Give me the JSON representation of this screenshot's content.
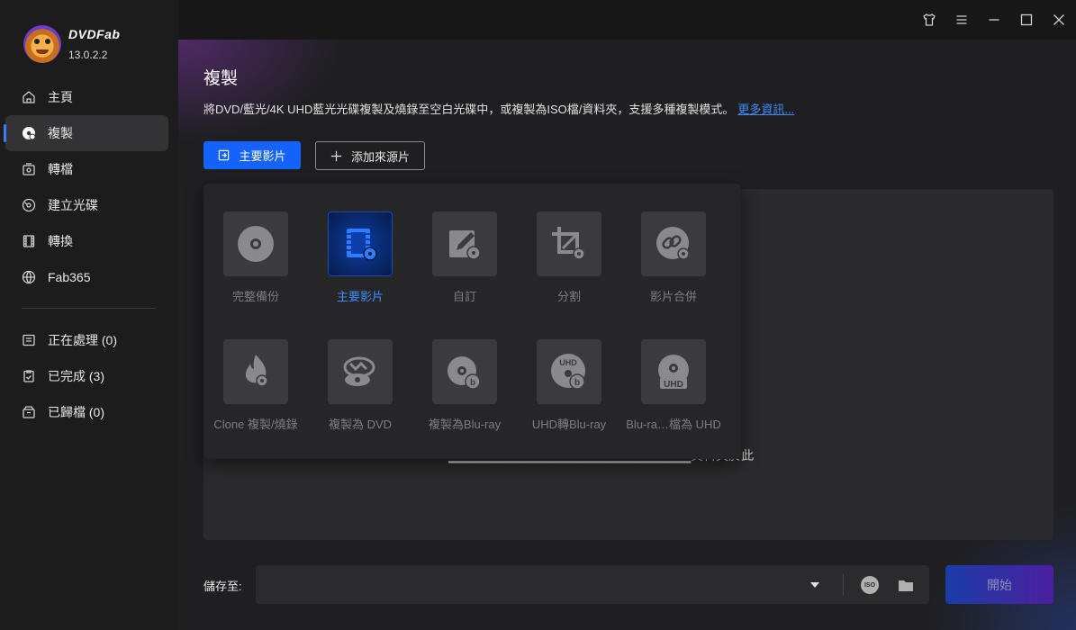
{
  "app": {
    "brand": "DVDFab",
    "version": "13.0.2.2"
  },
  "sidebar": {
    "items": [
      {
        "label": "主頁",
        "icon": "home-icon"
      },
      {
        "label": "複製",
        "icon": "disc-copy-icon",
        "active": true
      },
      {
        "label": "轉檔",
        "icon": "convert-icon"
      },
      {
        "label": "建立光碟",
        "icon": "create-disc-icon"
      },
      {
        "label": "轉換",
        "icon": "film-icon"
      },
      {
        "label": "Fab365",
        "icon": "fab365-icon"
      }
    ],
    "queue": [
      {
        "label": "正在處理 (0)",
        "icon": "processing-icon"
      },
      {
        "label": "已完成 (3)",
        "icon": "completed-icon"
      },
      {
        "label": "已歸檔 (0)",
        "icon": "archive-icon"
      }
    ]
  },
  "page": {
    "title": "複製",
    "description": "將DVD/藍光/4K UHD藍光光碟複製及燒錄至空白光碟中，或複製為ISO檔/資料夾，支援多種複製模式。",
    "more_link": "更多資訊...",
    "primary_button": "主要影片",
    "add_source_button": "添加來源片",
    "drop_hint": "資料夾於此"
  },
  "modes": [
    {
      "label": "完整備份",
      "icon": "full-disc-icon"
    },
    {
      "label": "主要影片",
      "icon": "main-movie-icon",
      "active": true
    },
    {
      "label": "自訂",
      "icon": "customize-icon"
    },
    {
      "label": "分割",
      "icon": "split-icon"
    },
    {
      "label": "影片合併",
      "icon": "merge-icon"
    },
    {
      "label": "Clone 複製/燒錄",
      "icon": "clone-burn-icon"
    },
    {
      "label": "複製為 DVD",
      "icon": "bluray-to-dvd-icon"
    },
    {
      "label": "複製為Blu-ray",
      "icon": "copy-to-bluray-icon"
    },
    {
      "label": "UHD轉Blu-ray",
      "icon": "uhd-to-bluray-icon"
    },
    {
      "label": "Blu-ra…檔為 UHD",
      "icon": "bluray-to-uhd-icon"
    }
  ],
  "footer": {
    "save_label": "儲存至:",
    "iso_label": "ISO",
    "start_button": "開始"
  },
  "colors": {
    "accent": "#1463ff",
    "link": "#3d8bff",
    "sidebar_bg": "#1c1c1d"
  }
}
